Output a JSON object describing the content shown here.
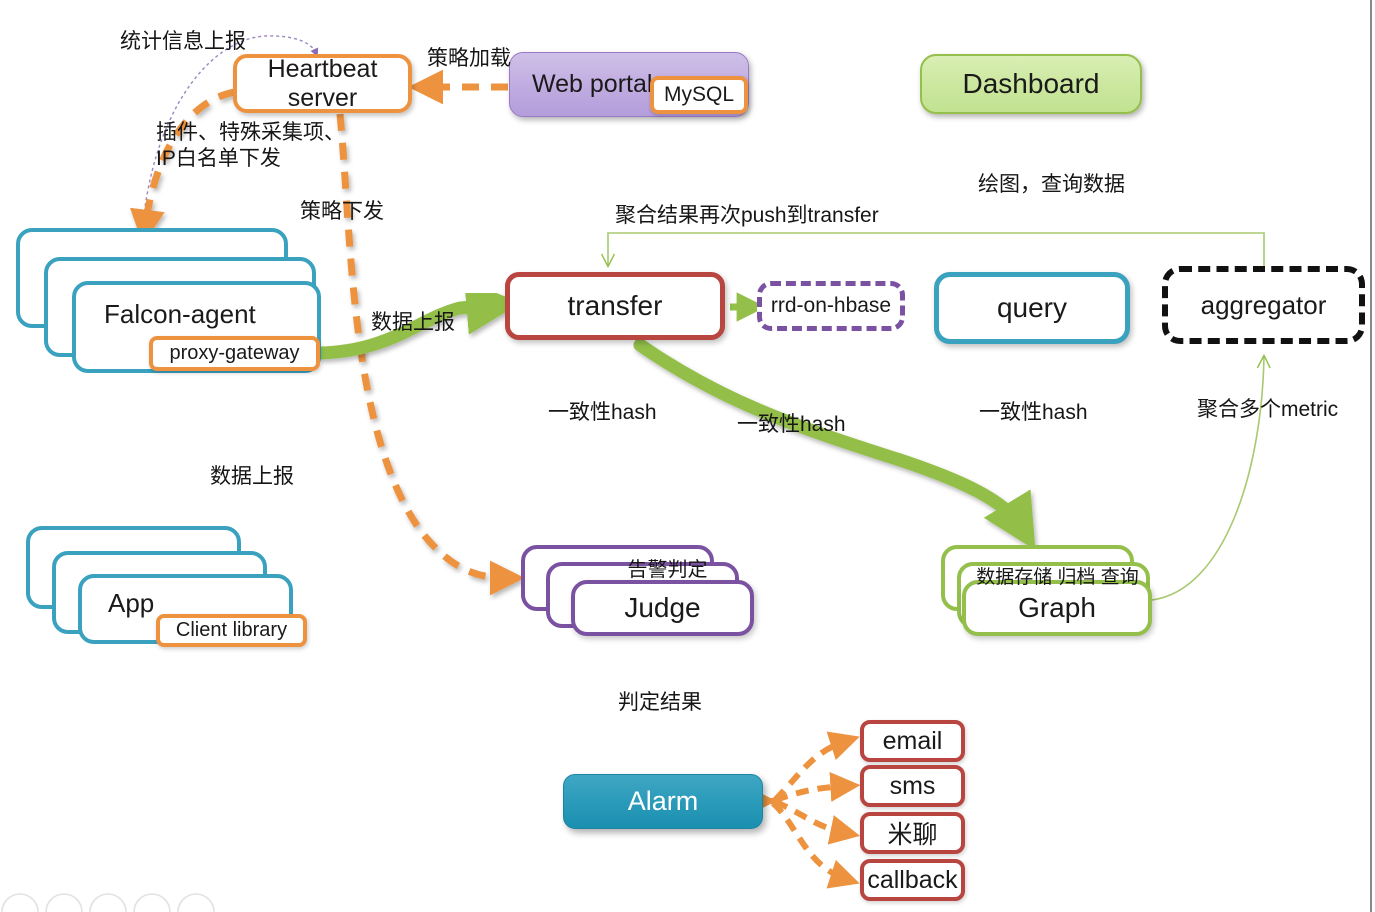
{
  "diagram": {
    "title": "Open-Falcon monitoring architecture",
    "colors": {
      "orange": "#ed9340",
      "teal": "#3aa2bf",
      "green": "#93bf4a",
      "red": "#b8453f",
      "purple": "#7a52a1",
      "lavender": "#b49ddb",
      "blue": "#3f7cc0",
      "black": "#111111"
    }
  },
  "nodes": {
    "heartbeat": {
      "line1": "Heartbeat",
      "line2": "server"
    },
    "web_portal": {
      "label": "Web portal"
    },
    "mysql": {
      "label": "MySQL"
    },
    "dashboard": {
      "label": "Dashboard"
    },
    "falcon_agent": {
      "label": "Falcon-agent"
    },
    "proxy_gateway": {
      "label": "proxy-gateway"
    },
    "app": {
      "label": "App"
    },
    "client_library": {
      "label": "Client library"
    },
    "transfer": {
      "label": "transfer"
    },
    "rrd_on_hbase": {
      "label": "rrd-on-hbase"
    },
    "query": {
      "label": "query"
    },
    "aggregator": {
      "label": "aggregator"
    },
    "judge": {
      "label": "Judge",
      "caption": "告警判定"
    },
    "graph": {
      "label": "Graph",
      "caption": "数据存储 归档 查询"
    },
    "alarm": {
      "label": "Alarm"
    },
    "email": {
      "label": "email"
    },
    "sms": {
      "label": "sms"
    },
    "michat": {
      "label": "米聊"
    },
    "callback": {
      "label": "callback"
    }
  },
  "edge_labels": {
    "stats_report": "统计信息上报",
    "plugin_push": "插件、特殊采集项、\nIP白名单下发",
    "policy_load": "策略加载",
    "policy_push": "策略下发",
    "data_report_agent": "数据上报",
    "data_report_app": "数据上报",
    "agg_push_back": "聚合结果再次push到transfer",
    "draw_query": "绘图，查询数据",
    "hash_judge": "一致性hash",
    "hash_graph": "一致性hash",
    "hash_query": "一致性hash",
    "agg_metric": "聚合多个metric",
    "judge_result": "判定结果"
  }
}
